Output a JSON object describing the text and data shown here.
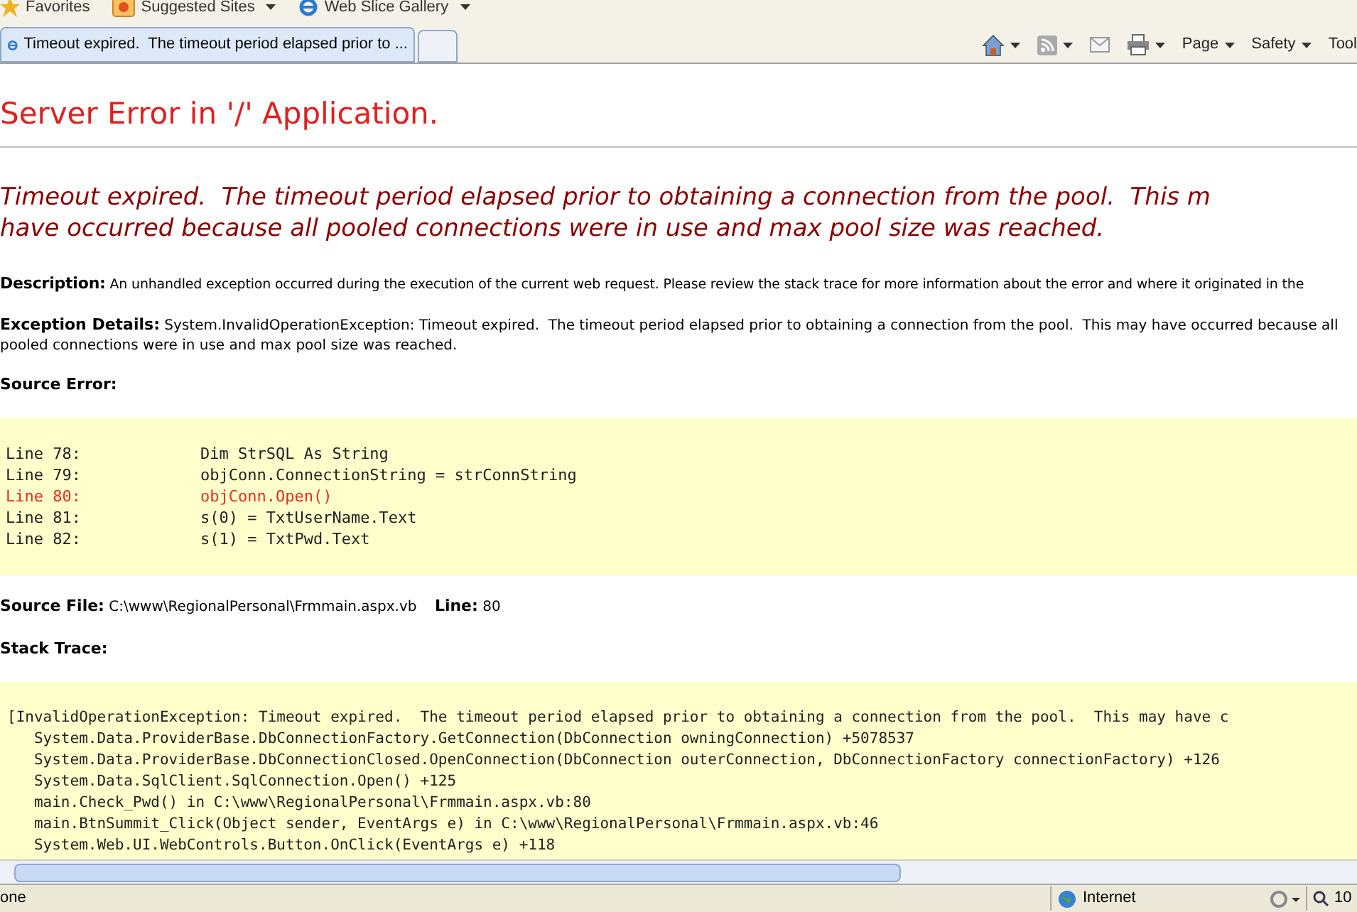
{
  "favorites_bar": {
    "items": [
      {
        "label": "Favorites",
        "kind": "star"
      },
      {
        "label": "Suggested Sites",
        "kind": "sites"
      },
      {
        "label": "Web Slice Gallery",
        "kind": "slice"
      }
    ]
  },
  "tab_bar": {
    "tabs": [
      {
        "label": "Timeout expired.  The timeout period elapsed prior to ...",
        "selected": true
      }
    ],
    "commands": [
      {
        "label": "Page"
      },
      {
        "label": "Safety"
      },
      {
        "label": "Tool"
      }
    ]
  },
  "page": {
    "title": "Server Error in '/' Application.",
    "message_lines": [
      "Timeout expired.  The timeout period elapsed prior to obtaining a connection from the pool.  This m",
      "have occurred because all pooled connections were in use and max pool size was reached."
    ],
    "description": {
      "label": "Description:",
      "text": "An unhandled exception occurred during the execution of the current web request. Please review the stack trace for more information about the error and where it originated in the"
    },
    "exception_details": {
      "label": "Exception Details:",
      "text": "System.InvalidOperationException: Timeout expired.  The timeout period elapsed prior to obtaining a connection from the pool.  This may have occurred because all pooled connections were in use and max pool size was reached."
    },
    "source_error": {
      "label": "Source Error:",
      "lines": [
        {
          "number": "Line 78:",
          "code": "        Dim StrSQL As String",
          "highlighted": false
        },
        {
          "number": "Line 79:",
          "code": "        objConn.ConnectionString = strConnString",
          "highlighted": false
        },
        {
          "number": "Line 80:",
          "code": "        objConn.Open()",
          "highlighted": true
        },
        {
          "number": "Line 81:",
          "code": "        s(0) = TxtUserName.Text",
          "highlighted": false
        },
        {
          "number": "Line 82:",
          "code": "        s(1) = TxtPwd.Text",
          "highlighted": false
        }
      ]
    },
    "source_file": {
      "label": "Source File:",
      "path": "C:\\www\\RegionalPersonal\\Frmmain.aspx.vb",
      "line_label": "Line:",
      "line": "80"
    },
    "stack_trace": {
      "label": "Stack Trace:",
      "lines": [
        "[InvalidOperationException: Timeout expired.  The timeout period elapsed prior to obtaining a connection from the pool.  This may have c",
        "   System.Data.ProviderBase.DbConnectionFactory.GetConnection(DbConnection owningConnection) +5078537",
        "   System.Data.ProviderBase.DbConnectionClosed.OpenConnection(DbConnection outerConnection, DbConnectionFactory connectionFactory) +126",
        "   System.Data.SqlClient.SqlConnection.Open() +125",
        "   main.Check_Pwd() in C:\\www\\RegionalPersonal\\Frmmain.aspx.vb:80",
        "   main.BtnSummit_Click(Object sender, EventArgs e) in C:\\www\\RegionalPersonal\\Frmmain.aspx.vb:46",
        "   System.Web.UI.WebControls.Button.OnClick(EventArgs e) +118"
      ]
    }
  },
  "status_bar": {
    "status": "one",
    "zone": "Internet",
    "zoom": "10"
  }
}
